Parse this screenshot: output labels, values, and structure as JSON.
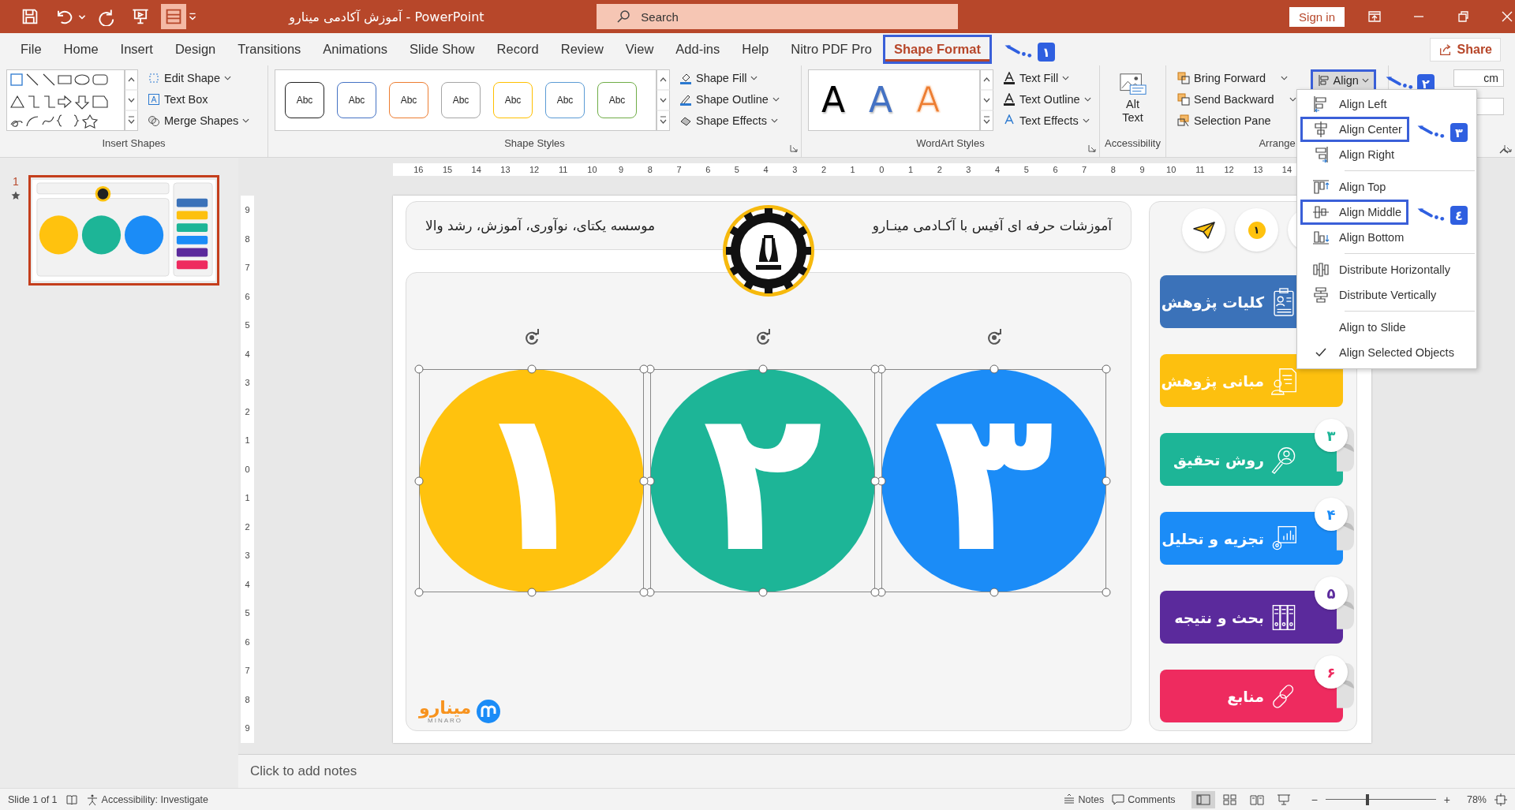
{
  "window": {
    "title": "آموزش آکادمی مینارو  -  PowerPoint",
    "search_placeholder": "Search",
    "sign_in": "Sign in"
  },
  "tabs": [
    {
      "label": "File",
      "selected": false,
      "highlighted": false
    },
    {
      "label": "Home",
      "selected": false,
      "highlighted": false
    },
    {
      "label": "Insert",
      "selected": false,
      "highlighted": false
    },
    {
      "label": "Design",
      "selected": false,
      "highlighted": false
    },
    {
      "label": "Transitions",
      "selected": false,
      "highlighted": false
    },
    {
      "label": "Animations",
      "selected": false,
      "highlighted": false
    },
    {
      "label": "Slide Show",
      "selected": false,
      "highlighted": false
    },
    {
      "label": "Record",
      "selected": false,
      "highlighted": false
    },
    {
      "label": "Review",
      "selected": false,
      "highlighted": false
    },
    {
      "label": "View",
      "selected": false,
      "highlighted": false
    },
    {
      "label": "Add-ins",
      "selected": false,
      "highlighted": false
    },
    {
      "label": "Help",
      "selected": false,
      "highlighted": false
    },
    {
      "label": "Nitro PDF Pro",
      "selected": false,
      "highlighted": false
    },
    {
      "label": "Shape Format",
      "selected": true,
      "highlighted": true,
      "callout": "١"
    }
  ],
  "share": "Share",
  "insert_shapes": {
    "label": "Insert Shapes",
    "commands": [
      "Edit Shape",
      "Text Box",
      "Merge Shapes"
    ]
  },
  "shape_styles": {
    "label": "Shape Styles",
    "swatches": [
      {
        "text": "Abc",
        "color": "#222222"
      },
      {
        "text": "Abc",
        "color": "#4472c4"
      },
      {
        "text": "Abc",
        "color": "#ed7d31"
      },
      {
        "text": "Abc",
        "color": "#a5a5a5"
      },
      {
        "text": "Abc",
        "color": "#ffc000"
      },
      {
        "text": "Abc",
        "color": "#5b9bd5"
      },
      {
        "text": "Abc",
        "color": "#70ad47"
      }
    ],
    "commands": [
      "Shape Fill",
      "Shape Outline",
      "Shape Effects"
    ]
  },
  "wordart_styles": {
    "label": "WordArt Styles",
    "samples": [
      {
        "text": "A",
        "kind": "solid",
        "color": "#000000"
      },
      {
        "text": "A",
        "kind": "solid",
        "color": "#4472c4"
      },
      {
        "text": "A",
        "kind": "outline",
        "color": "#ed7d31"
      }
    ],
    "commands": [
      "Text Fill",
      "Text Outline",
      "Text Effects"
    ]
  },
  "accessibility": {
    "label": "Accessibility",
    "command": "Alt Text"
  },
  "arrange": {
    "label": "Arrange",
    "commands": [
      "Bring Forward",
      "Send Backward",
      "Selection Pane"
    ],
    "align": {
      "label": "Align",
      "highlighted": true,
      "callout": "٢"
    }
  },
  "size": {
    "unit": "cm"
  },
  "align_menu": [
    {
      "label": "Align Left",
      "highlighted": false,
      "checked": false,
      "divider_above": false
    },
    {
      "label": "Align Center",
      "highlighted": true,
      "checked": false,
      "divider_above": false,
      "callout": "٣"
    },
    {
      "label": "Align Right",
      "highlighted": false,
      "checked": false,
      "divider_above": false
    },
    {
      "label": "Align Top",
      "highlighted": false,
      "checked": false,
      "divider_above": true
    },
    {
      "label": "Align Middle",
      "highlighted": true,
      "checked": false,
      "divider_above": false,
      "callout": "٤"
    },
    {
      "label": "Align Bottom",
      "highlighted": false,
      "checked": false,
      "divider_above": false
    },
    {
      "label": "Distribute Horizontally",
      "highlighted": false,
      "checked": false,
      "divider_above": true
    },
    {
      "label": "Distribute Vertically",
      "highlighted": false,
      "checked": false,
      "divider_above": false
    },
    {
      "label": "Align to Slide",
      "highlighted": false,
      "checked": false,
      "divider_above": true
    },
    {
      "label": "Align Selected Objects",
      "highlighted": false,
      "checked": true,
      "divider_above": false
    }
  ],
  "slides_pane": [
    {
      "number": "1",
      "selected": true,
      "animated": true
    }
  ],
  "ruler": {
    "horizontal": [
      "16",
      "15",
      "14",
      "13",
      "12",
      "11",
      "10",
      "9",
      "8",
      "7",
      "6",
      "5",
      "4",
      "3",
      "2",
      "1",
      "0",
      "1",
      "2",
      "3",
      "4",
      "5",
      "6",
      "7",
      "8",
      "9",
      "10",
      "11",
      "12",
      "13",
      "14"
    ],
    "vertical": [
      "9",
      "8",
      "7",
      "6",
      "5",
      "4",
      "3",
      "2",
      "1",
      "0",
      "1",
      "2",
      "3",
      "4",
      "5",
      "6",
      "7",
      "8",
      "9"
    ]
  },
  "slide": {
    "header": {
      "title": "آموزشات حرفه ای آفیس با آکـادمی مینـارو",
      "motto": "موسسه یکتای، نوآوری، آموزش، رشد والا"
    },
    "shapes": [
      {
        "digit": "۳",
        "color": "#1b8cf7",
        "selected": true
      },
      {
        "digit": "۲",
        "color": "#1db597",
        "selected": true
      },
      {
        "digit": "۱",
        "color": "#ffc20e",
        "selected": true
      }
    ],
    "brand": {
      "wordmark": "مینارو",
      "tagline": "MINARO"
    },
    "top_buttons": [
      {
        "kind": "send"
      },
      {
        "kind": "number",
        "text": "۱"
      },
      {
        "kind": "blank"
      }
    ],
    "menu": [
      {
        "label": "کلیات پژوهش",
        "color": "#3b72b9"
      },
      {
        "label": "مبانی پژوهش",
        "color": "#fdc00f"
      },
      {
        "label": "روش تحقیق",
        "color": "#1db597",
        "badge": "۳"
      },
      {
        "label": "تجزیه و تحلیل",
        "color": "#1b8cf7",
        "badge": "۴"
      },
      {
        "label": "بحث و نتیجه",
        "color": "#5b2a9c",
        "badge": "۵"
      },
      {
        "label": "منابع",
        "color": "#ee2b5f",
        "badge": "۶"
      }
    ]
  },
  "notes_placeholder": "Click to add notes",
  "status_bar": {
    "slide": "Slide 1 of 1",
    "accessibility": "Accessibility: Investigate",
    "notes": "Notes",
    "comments": "Comments",
    "views": [
      {
        "selected": true
      },
      {
        "selected": false
      },
      {
        "selected": false
      },
      {
        "selected": false
      }
    ],
    "zoom": {
      "minus": "−",
      "plus": "+",
      "level": 0.38,
      "reading": "78%"
    }
  }
}
